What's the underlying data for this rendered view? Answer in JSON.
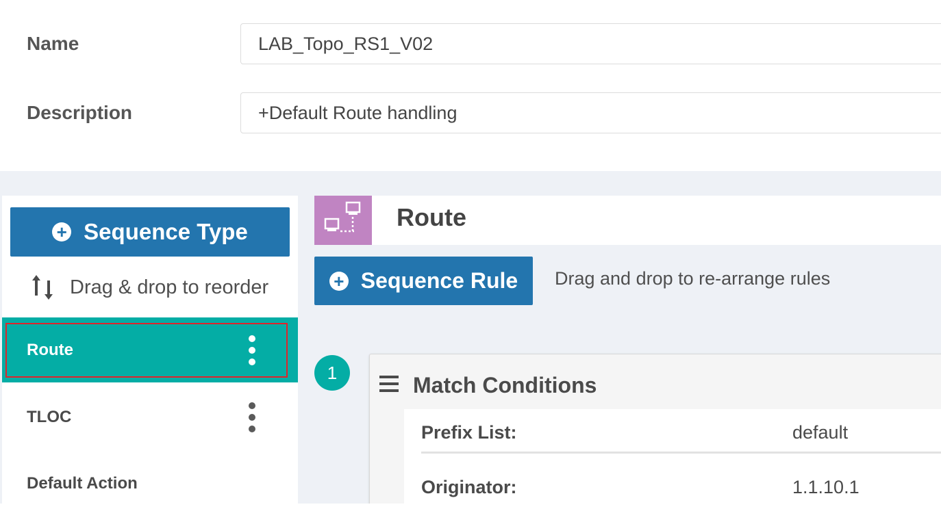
{
  "form": {
    "name_label": "Name",
    "name_value": "LAB_Topo_RS1_V02",
    "description_label": "Description",
    "description_value": "+Default Route handling"
  },
  "sidebar": {
    "add_button_label": "Sequence Type",
    "add_button_icon": "plus-circle-icon",
    "drag_hint": "Drag & drop to reorder",
    "drag_icon": "reorder-arrows-icon",
    "items": [
      {
        "label": "Route",
        "selected": true,
        "has_menu": true
      },
      {
        "label": "TLOC",
        "selected": false,
        "has_menu": true
      },
      {
        "label": "Default Action",
        "selected": false,
        "has_menu": false
      }
    ]
  },
  "main": {
    "section_title": "Route",
    "section_icon": "route-network-icon",
    "add_rule_label": "Sequence Rule",
    "rule_hint": "Drag and drop to re-arrange rules",
    "rules": [
      {
        "number": "1",
        "card_title": "Match Conditions",
        "conditions": [
          {
            "key": "Prefix List:",
            "value": "default"
          },
          {
            "key": "Originator:",
            "value": "1.1.10.1"
          }
        ]
      }
    ]
  },
  "colors": {
    "primary_blue": "#2375ae",
    "teal": "#04ada5",
    "route_icon_bg": "#c084c2",
    "highlight_red": "#e0242a",
    "band_grey": "#eef1f6"
  }
}
